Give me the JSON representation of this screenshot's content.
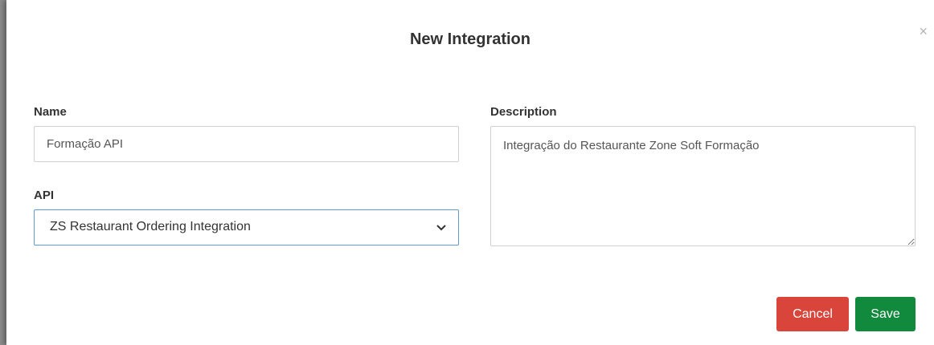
{
  "dialog": {
    "title": "New Integration",
    "close_symbol": "×"
  },
  "form": {
    "name": {
      "label": "Name",
      "value": "Formação API"
    },
    "api": {
      "label": "API",
      "selected": "ZS Restaurant Ordering Integration"
    },
    "description": {
      "label": "Description",
      "value": "Integração do Restaurante Zone Soft Formação"
    }
  },
  "actions": {
    "cancel_label": "Cancel",
    "save_label": "Save"
  },
  "colors": {
    "cancel": "#d9453a",
    "save": "#128a3e",
    "focus_border": "#5b9bd5"
  },
  "icons": {
    "close": "close-icon",
    "select_arrow": "chevron-down-icon"
  }
}
